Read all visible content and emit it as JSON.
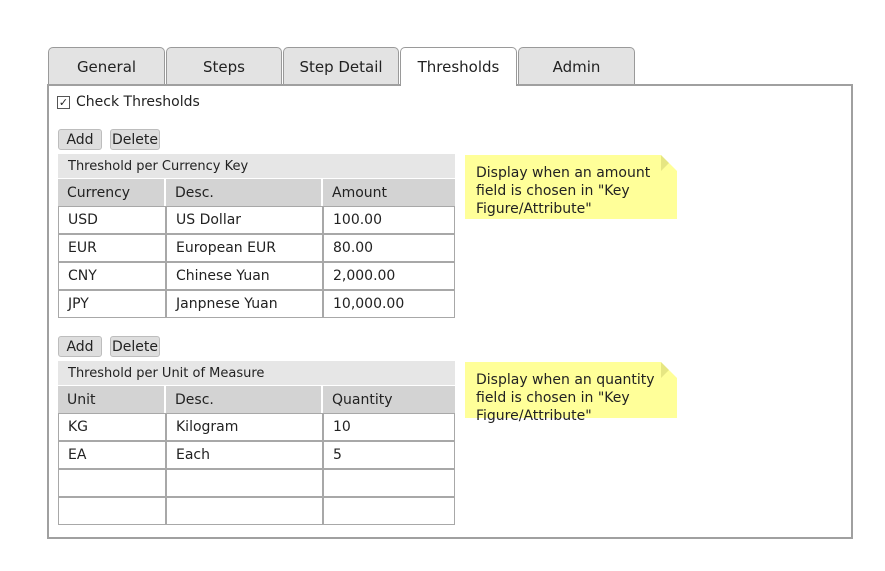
{
  "tabs": [
    {
      "label": "General",
      "active": false
    },
    {
      "label": "Steps",
      "active": false
    },
    {
      "label": "Step Detail",
      "active": false
    },
    {
      "label": "Thresholds",
      "active": true
    },
    {
      "label": "Admin",
      "active": false
    }
  ],
  "check_thresholds": {
    "label": "Check Thresholds",
    "checked": true,
    "mark": "✓"
  },
  "currency_section": {
    "add_label": "Add",
    "delete_label": "Delete",
    "title": "Threshold per Currency Key",
    "columns": [
      "Currency",
      "Desc.",
      "Amount"
    ],
    "rows": [
      [
        "USD",
        "US Dollar",
        "100.00"
      ],
      [
        "EUR",
        "European EUR",
        "80.00"
      ],
      [
        "CNY",
        "Chinese Yuan",
        "2,000.00"
      ],
      [
        "JPY",
        "Janpnese Yuan",
        "10,000.00"
      ]
    ],
    "note": "Display when an amount field is chosen in \"Key Figure/Attribute\""
  },
  "uom_section": {
    "add_label": "Add",
    "delete_label": "Delete",
    "title": "Threshold per Unit of Measure",
    "columns": [
      "Unit",
      "Desc.",
      "Quantity"
    ],
    "rows": [
      [
        "KG",
        "Kilogram",
        "10"
      ],
      [
        "EA",
        "Each",
        "5"
      ],
      [
        "",
        "",
        ""
      ],
      [
        "",
        "",
        ""
      ]
    ],
    "note": "Display when an quantity field is chosen in \"Key Figure/Attribute\""
  }
}
